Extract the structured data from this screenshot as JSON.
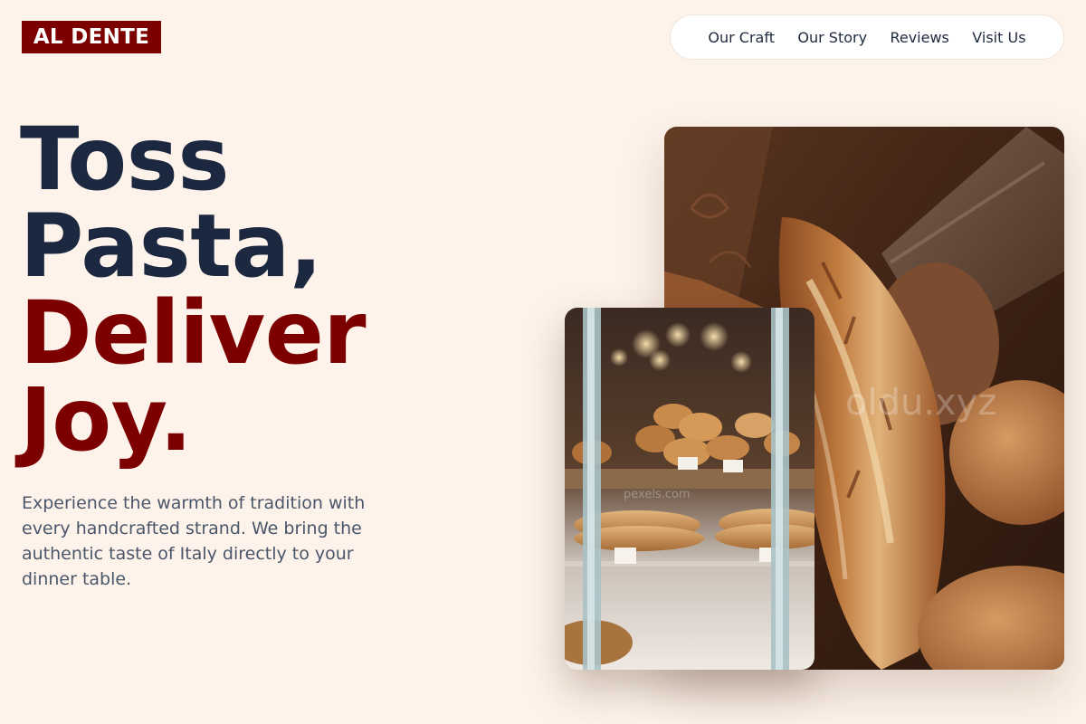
{
  "brand": {
    "logo_text": "AL DENTE",
    "color": "#7d0000"
  },
  "nav": {
    "links": [
      "Our Craft",
      "Our Story",
      "Reviews",
      "Visit Us"
    ]
  },
  "hero": {
    "headline_lines": [
      "Toss",
      "Pasta,",
      "Deliver",
      "Joy."
    ],
    "headline_colors": [
      "#1c2840",
      "#1c2840",
      "#7d0000",
      "#7d0000"
    ],
    "description": "Experience the warmth of tradition with every handcrafted strand. We bring the authentic taste of Italy directly to your dinner table."
  },
  "images": {
    "main": "bread-photo",
    "inset": "bakery-display-case-photo"
  },
  "colors": {
    "background": "#fdf3ea",
    "dark_text": "#1c2840",
    "accent": "#7d0000"
  }
}
